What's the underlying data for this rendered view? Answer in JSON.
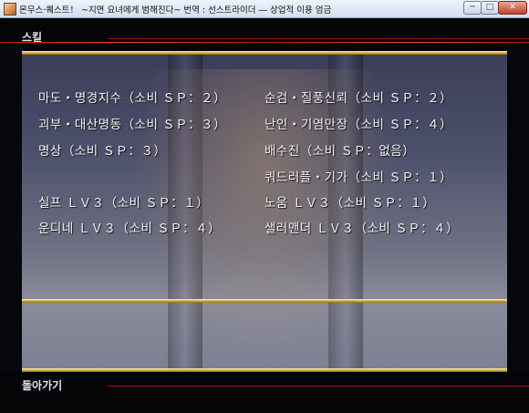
{
  "window": {
    "title": "몬무스·퀘스트！ ~지면 요녀에게 범해진다~ 번역 : 선스트라이더 ― 상업적 이용 엄금",
    "min_symbol": "─",
    "max_symbol": "□",
    "close_symbol": "✕",
    "icon": "app-icon"
  },
  "header": {
    "label": "스킬"
  },
  "skills": [
    {
      "text": "마도・명경지수（소비 ＳＰ：２）"
    },
    {
      "text": "순검・질풍신뢰（소비 ＳＰ：２）"
    },
    {
      "text": "괴부・대산명동（소비 ＳＰ：３）"
    },
    {
      "text": "난인・기염만장（소비 ＳＰ：４）"
    },
    {
      "text": "명상（소비 ＳＰ：３）"
    },
    {
      "text": "배수진（소비 ＳＰ：없음）"
    },
    {
      "text": "쿼드러플・기가（소비 ＳＰ：１）"
    },
    {
      "text": "실프 ＬＶ３（소비 ＳＰ：１）"
    },
    {
      "text": "노움 ＬＶ３（소비 ＳＰ：１）"
    },
    {
      "text": "운디네 ＬＶ３（소비 ＳＰ：４）"
    },
    {
      "text": "샐러맨더 ＬＶ３（소비 ＳＰ：４）"
    }
  ],
  "footer": {
    "back_label": "돌아가기"
  },
  "colors": {
    "gold": "#d7b23f",
    "red_line": "#b81a1a",
    "text": "#f3f3f6"
  }
}
